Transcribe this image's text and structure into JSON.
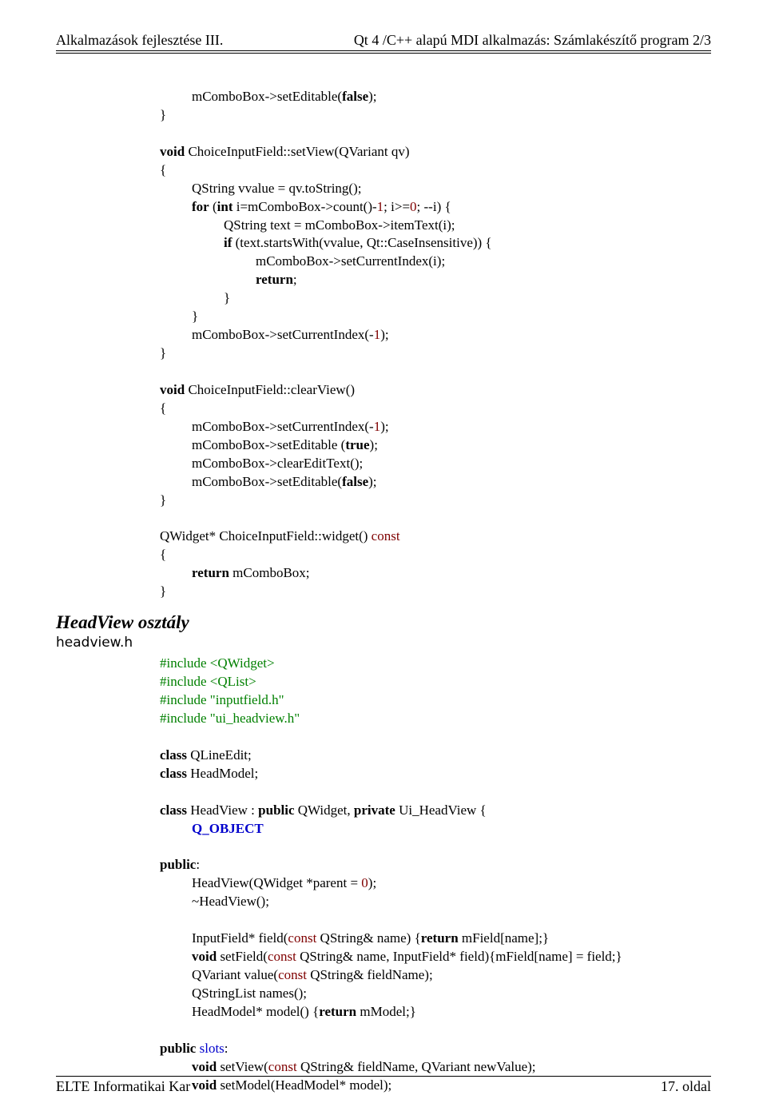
{
  "header": {
    "left": "Alkalmazások fejlesztése III.",
    "right": "Qt 4 /C++ alapú MDI alkalmazás: Számlakészítő program 2/3"
  },
  "footer": {
    "left": "ELTE Informatikai Kar",
    "right": "17. oldal"
  },
  "section": {
    "title": "HeadView osztály",
    "file": "headview.h"
  },
  "code1": {
    "l1a": "}",
    "l1b_pre": "mComboBox->setEditable(",
    "l1b_kw": "false",
    "l1b_post": ");",
    "l2_kw": "void",
    "l2_rest": " ChoiceInputField::setView(QVariant qv)",
    "l3": "{",
    "l4_pre": "QString vvalue = qv.toString();",
    "l5_kw_for": "for",
    "l5_a": " (",
    "l5_kw_int": "int",
    "l5_b": " i=mComboBox->count()-",
    "l5_n1": "1",
    "l5_c": "; i>=",
    "l5_n0": "0",
    "l5_d": "; --i) {",
    "l6": "QString text = mComboBox->itemText(i);",
    "l7_kw_if": "if",
    "l7_rest": " (text.startsWith(vvalue, Qt::CaseInsensitive)) {",
    "l8": "mComboBox->setCurrentIndex(i);",
    "l9_kw_return": "return",
    "l9_semi": ";",
    "l10": "}",
    "l11": "}",
    "l12_pre": "mComboBox->setCurrentIndex(-",
    "l12_n": "1",
    "l12_post": ");",
    "l13": "}",
    "l14_kw": "void",
    "l14_rest": " ChoiceInputField::clearView()",
    "l15": "{",
    "l16_pre": "mComboBox->setCurrentIndex(-",
    "l16_n": "1",
    "l16_post": ");",
    "l17_pre": "mComboBox->setEditable (",
    "l17_kw": "true",
    "l17_post": ");",
    "l18": "mComboBox->clearEditText();",
    "l19_pre": "mComboBox->setEditable(",
    "l19_kw": "false",
    "l19_post": ");",
    "l20": "}",
    "l21_pre": "QWidget* ChoiceInputField::widget() ",
    "l21_red": "const",
    "l22": "{",
    "l23_kw": "return",
    "l23_rest": " mComboBox;",
    "l24": "}"
  },
  "code2": {
    "i1": "#include <QWidget>",
    "i2": "#include <QList>",
    "i3": "#include \"inputfield.h\"",
    "i4": "#include \"ui_headview.h\"",
    "c1_kw": "class",
    "c1_rest": " QLineEdit;",
    "c2_kw": "class",
    "c2_rest": " HeadModel;",
    "c3_a": "class",
    "c3_b": " HeadView : ",
    "c3_c": "public",
    "c3_d": " QWidget, ",
    "c3_e": "private",
    "c3_f": " Ui_HeadView {",
    "qo": "Q_OBJECT",
    "pub": "public",
    "pub_colon": ":",
    "ctor_a": "HeadView(QWidget *parent = ",
    "ctor_n": "0",
    "ctor_b": ");",
    "dtor": "~HeadView();",
    "f1_a": "InputField* field(",
    "f1_b": "const",
    "f1_c": " QString& name) {",
    "f1_d": "return",
    "f1_e": " mField[name];}",
    "f2_kw": "void",
    "f2_b": " setField(",
    "f2_c": "const",
    "f2_d": " QString& name, InputField* field){mField[name] = field;}",
    "f3_a": "QVariant value(",
    "f3_b": "const",
    "f3_c": " QString& fieldName);",
    "f4": "QStringList names();",
    "f5_a": "HeadModel* model() {",
    "f5_b": "return",
    "f5_c": " mModel;}",
    "ps_a": "public",
    "ps_b": "slots",
    "ps_colon": ":",
    "s1_kw": "void",
    "s1_a": " setView(",
    "s1_b": "const",
    "s1_c": " QString& fieldName, QVariant newValue);",
    "s2_kw": "void",
    "s2_a": " setModel(HeadModel* model);"
  }
}
